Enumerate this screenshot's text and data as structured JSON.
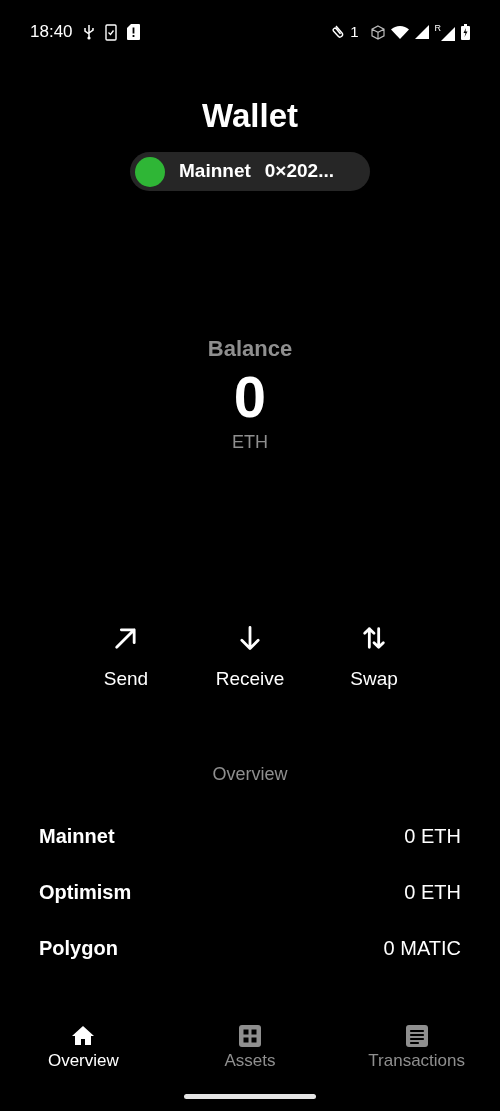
{
  "status_bar": {
    "time": "18:40",
    "notification_count": "1",
    "roaming": "R"
  },
  "header": {
    "title": "Wallet",
    "network": {
      "name": "Mainnet",
      "address": "0×202...",
      "color": "#2fb636"
    }
  },
  "balance": {
    "label": "Balance",
    "amount": "0",
    "unit": "ETH"
  },
  "actions": [
    {
      "kind": "send",
      "label": "Send"
    },
    {
      "kind": "receive",
      "label": "Receive"
    },
    {
      "kind": "swap",
      "label": "Swap"
    }
  ],
  "overview": {
    "title": "Overview",
    "rows": [
      {
        "network": "Mainnet",
        "amount": "0 ETH"
      },
      {
        "network": "Optimism",
        "amount": "0 ETH"
      },
      {
        "network": "Polygon",
        "amount": "0 MATIC"
      }
    ]
  },
  "nav": [
    {
      "kind": "overview",
      "label": "Overview",
      "selected": true
    },
    {
      "kind": "assets",
      "label": "Assets",
      "selected": false
    },
    {
      "kind": "transactions",
      "label": "Transactions",
      "selected": false
    }
  ]
}
